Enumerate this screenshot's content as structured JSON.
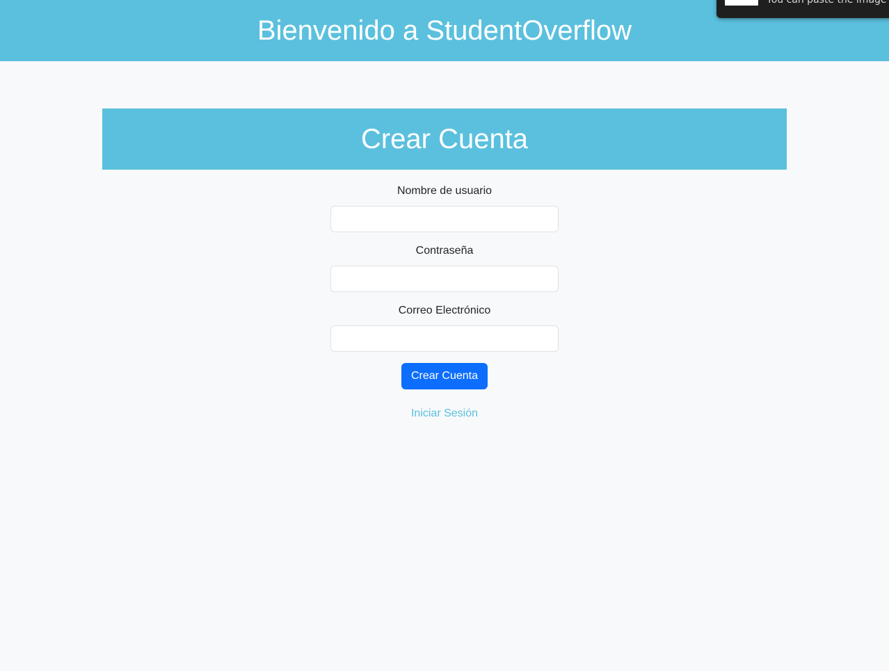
{
  "header": {
    "title": "Bienvenido a StudentOverflow"
  },
  "toast": {
    "text": "You can paste the image fr"
  },
  "card": {
    "title": "Crear Cuenta"
  },
  "form": {
    "username_label": "Nombre de usuario",
    "username_value": "",
    "password_label": "Contraseña",
    "password_value": "",
    "email_label": "Correo Electrónico",
    "email_value": "",
    "submit_label": "Crear Cuenta"
  },
  "links": {
    "login_label": "Iniciar Sesión"
  },
  "colors": {
    "header_bg": "#5bc0de",
    "page_bg": "#f8f9fa",
    "primary_button": "#0d6efd",
    "link": "#5bc0de"
  }
}
